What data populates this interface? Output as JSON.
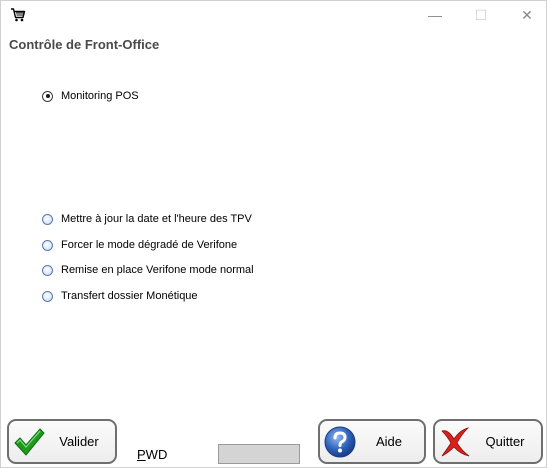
{
  "window": {
    "title_icon": "shopping-cart-icon",
    "controls": {
      "minimize": "—",
      "maximize": "☐",
      "close": "✕"
    }
  },
  "heading": "Contrôle de Front-Office",
  "options": [
    {
      "label": "Monitoring POS",
      "checked": true
    },
    {
      "label": "Mettre à jour la date et l'heure des TPV",
      "checked": false
    },
    {
      "label": "Forcer le mode dégradé de Verifone",
      "checked": false
    },
    {
      "label": "Remise en place Verifone mode normal",
      "checked": false
    },
    {
      "label": "Transfert dossier Monétique",
      "checked": false
    }
  ],
  "buttons": {
    "validate": {
      "label": "Valider",
      "icon": "green-check-icon"
    },
    "help": {
      "label": "Aide",
      "icon": "help-icon"
    },
    "quit": {
      "label": "Quitter",
      "icon": "red-x-icon"
    }
  },
  "pwd": {
    "label_first": "P",
    "label_rest": "WD",
    "value": ""
  },
  "colors": {
    "heading": "#4a4a4a",
    "check_green": "#1f9a1f",
    "help_blue": "#2c5fb8",
    "quit_red": "#d8201c"
  }
}
